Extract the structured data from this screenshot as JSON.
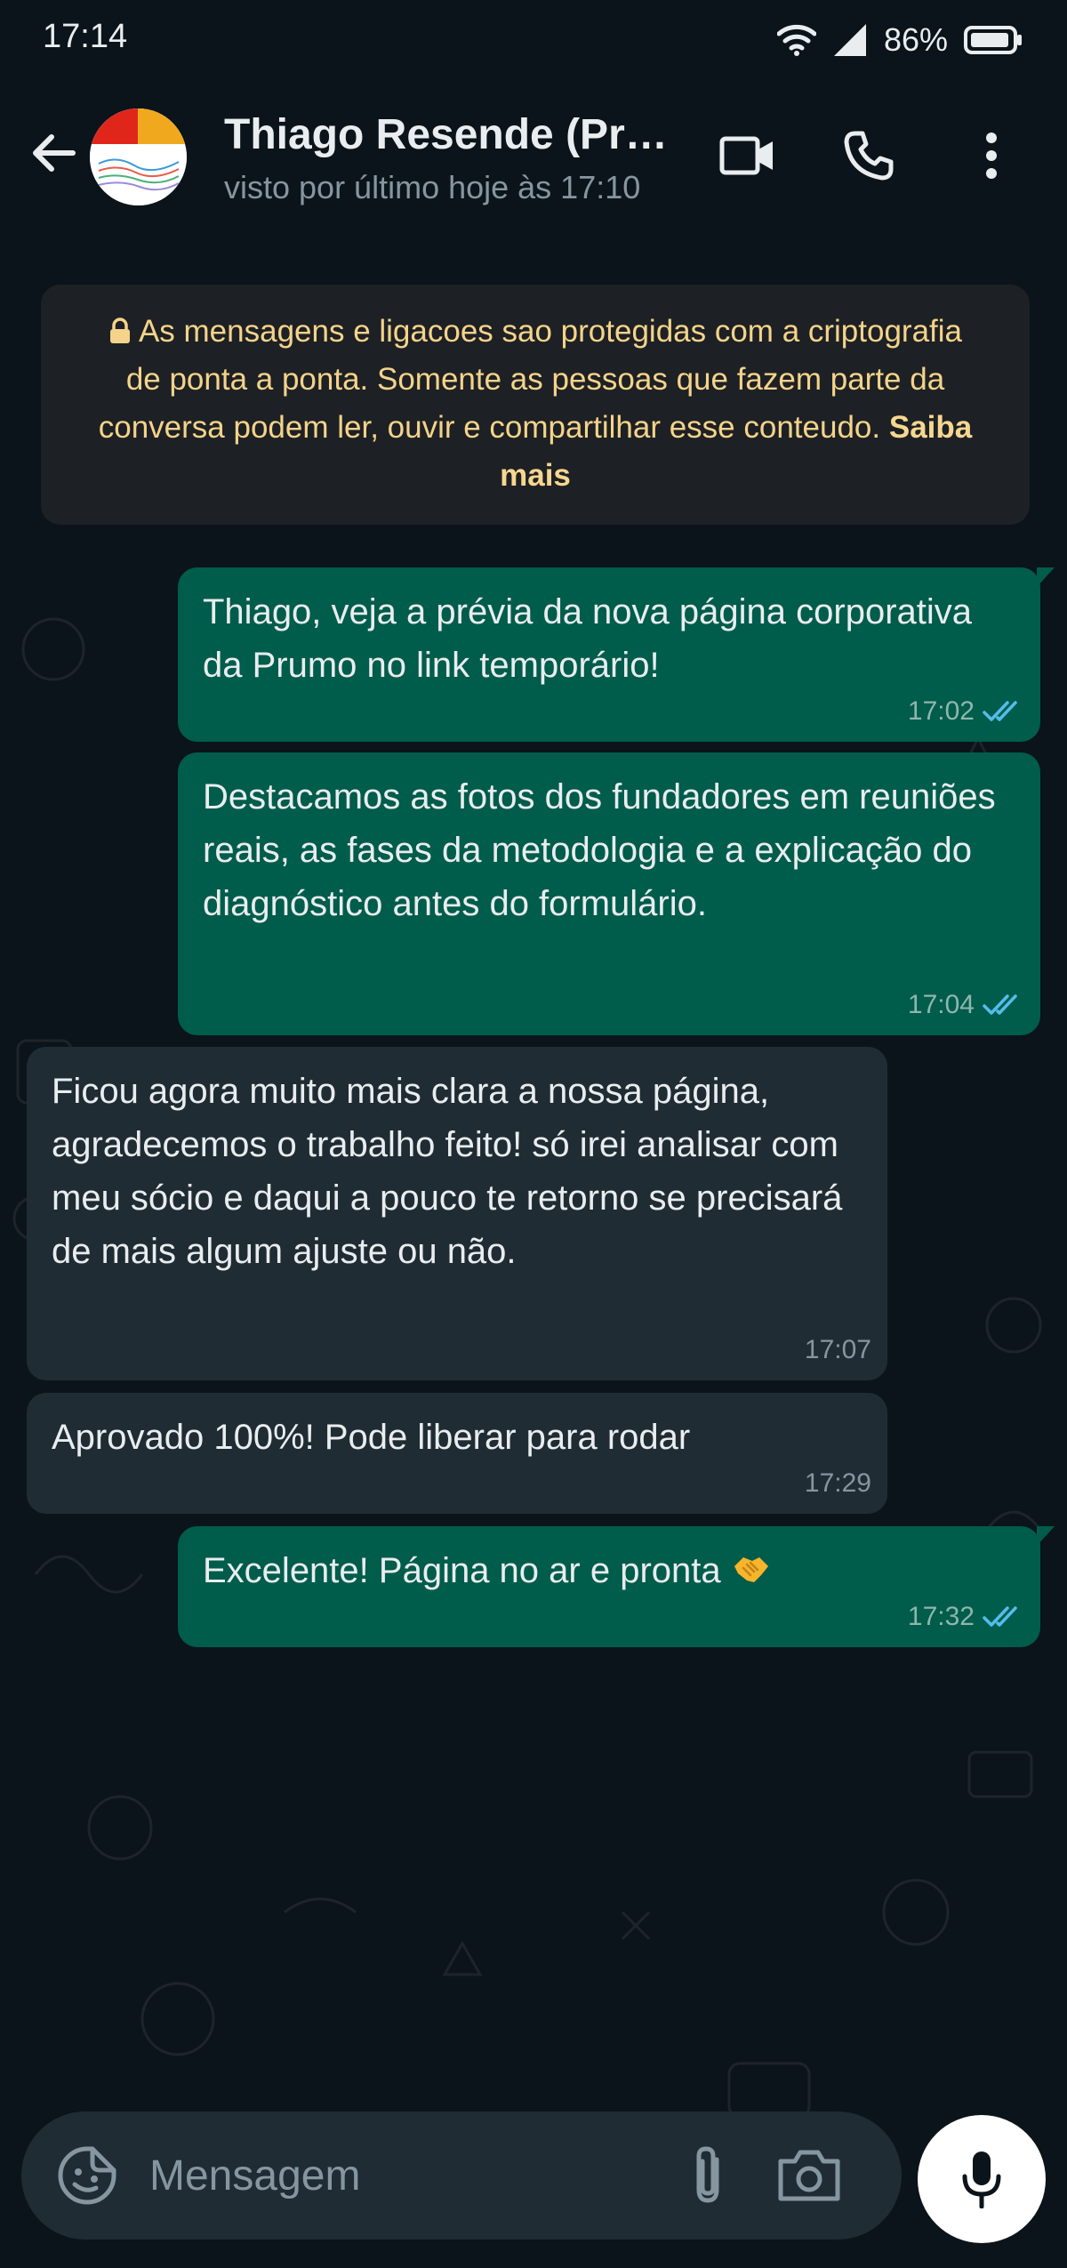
{
  "status_bar": {
    "time": "17:14",
    "battery_percent": "86%",
    "icons": [
      "wifi-icon",
      "cell-signal-icon",
      "battery-icon"
    ]
  },
  "header": {
    "contact_name": "Thiago Resende (Pru...",
    "last_seen": "visto por último hoje às 17:10",
    "actions": [
      "video-call-icon",
      "voice-call-icon",
      "more-options-icon"
    ]
  },
  "encryption_notice": {
    "text": "As mensagens e ligacoes sao protegidas com a criptografia de ponta a ponta. Somente as pessoas que fazem parte da conversa podem ler, ouvir e compartilhar esse conteudo.",
    "link": "Saiba mais"
  },
  "messages": [
    {
      "direction": "outgoing",
      "text": "Thiago, veja a prévia da nova página corporativa da Prumo no link temporário!",
      "time": "17:02",
      "status": "read"
    },
    {
      "direction": "outgoing",
      "text": "Destacamos as fotos dos fundadores em reuniões reais, as fases da metodologia e a explicação do diagnóstico antes do formulário.",
      "time": "17:04",
      "status": "read"
    },
    {
      "direction": "incoming",
      "text": "Ficou agora muito mais clara a nossa página, agradecemos o trabalho feito! só irei analisar com meu sócio e daqui a pouco te retorno se precisará de mais algum ajuste ou não.",
      "time": "17:07"
    },
    {
      "direction": "incoming",
      "text": "Aprovado 100%! Pode liberar para rodar",
      "time": "17:29"
    },
    {
      "direction": "outgoing",
      "text": "Excelente! Página no ar e pronta",
      "emoji": "handshake-emoji",
      "time": "17:32",
      "status": "read"
    }
  ],
  "composer": {
    "placeholder": "Mensagem",
    "icons": [
      "emoji-sticker-icon",
      "attach-icon",
      "camera-icon",
      "mic-icon"
    ]
  },
  "colors": {
    "background": "#0b141a",
    "outgoing_bubble": "#005c4b",
    "incoming_bubble": "#202c33",
    "read_ticks": "#53bdeb",
    "notice_text": "#f5d38a"
  }
}
